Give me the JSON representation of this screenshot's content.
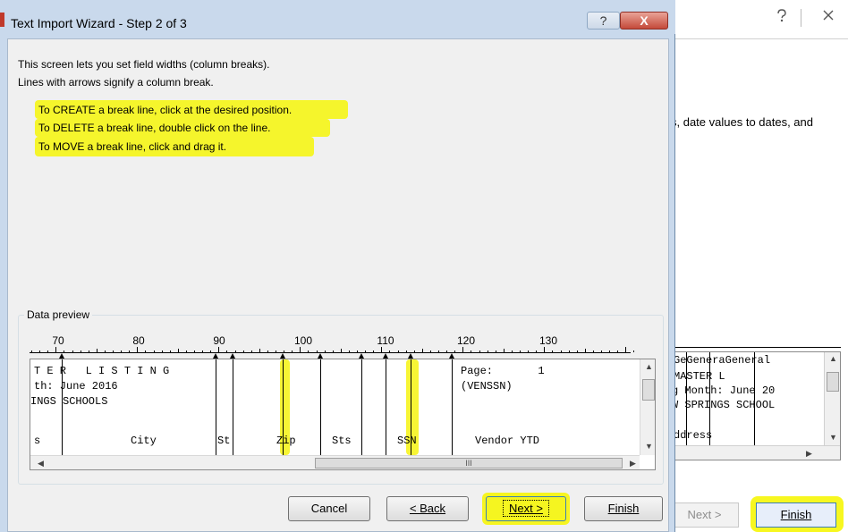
{
  "background_window": {
    "description_fragment": "s, date values to dates, and",
    "preview_header": [
      "Ge",
      "Genera",
      "General"
    ],
    "preview_rows": [
      "MASTER L",
      "g Month: June 20",
      "W SPRINGS SCHOOL",
      "",
      "ddress"
    ],
    "buttons": {
      "next": "Next >",
      "finish": "Finish"
    },
    "icons": {
      "help": "help-icon",
      "close": "close-icon"
    }
  },
  "dialog": {
    "title": "Text Import Wizard - Step 2 of 3",
    "help_label": "?",
    "close_label": "X",
    "intro_lines": [
      "This screen lets you set field widths (column breaks).",
      "Lines with arrows signify a column break."
    ],
    "instructions": [
      "To CREATE a break line, click at the desired position.",
      "To DELETE a break line, double click on the line.",
      "To MOVE a break line, click and drag it."
    ],
    "data_preview_label": "Data preview",
    "ruler_numbers": [
      "70",
      "80",
      "90",
      "100",
      "110",
      "120",
      "130"
    ],
    "preview_rows": [
      {
        "c1": "T E R   L I S T I N G",
        "c2": "Page:       1"
      },
      {
        "c1": "th: June 2016",
        "c2": "(VENSSN)"
      },
      {
        "c1": "INGS SCHOOLS",
        "c2": ""
      },
      {
        "c1": "",
        "c2": ""
      },
      {
        "col_s": "s",
        "city": "City",
        "st": "St",
        "zip": "Zip",
        "sts": "Sts",
        "ssn": "SSN",
        "vendor": "Vendor YTD"
      }
    ],
    "scroll_grip": "III",
    "buttons": {
      "cancel": "Cancel",
      "back": "< Back",
      "next": "Next >",
      "finish": "Finish"
    },
    "highlight_color": "#f5f52c"
  }
}
